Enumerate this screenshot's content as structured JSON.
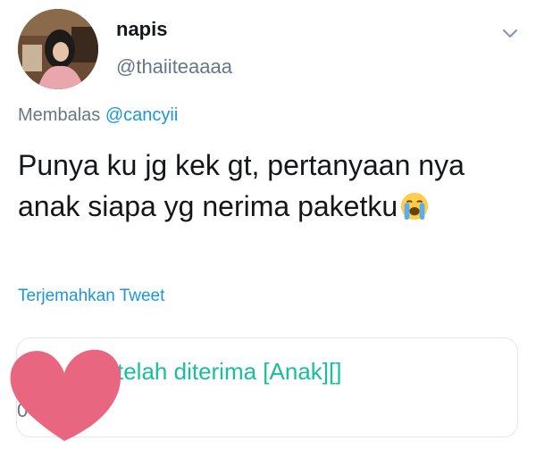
{
  "tweet": {
    "display_name": "napis",
    "handle": "@thaiiteaaaa",
    "reply_prefix": "Membalas",
    "reply_mention": "@cancyii",
    "text": "Punya ku jg kek gt, pertanyaan nya anak siapa yg nerima paketku",
    "emoji": "loudly-crying-face",
    "translate_label": "Terjemahkan Tweet"
  },
  "card": {
    "text": "telah diterima [Anak][]",
    "left_glyph": "^",
    "left_number": "0"
  },
  "icons": {
    "chevron": "chevron-down-icon",
    "redaction": "heart-sticker"
  },
  "colors": {
    "link": "#1b95e0",
    "card_text": "#17bf9e",
    "heart": "#e8667f"
  }
}
